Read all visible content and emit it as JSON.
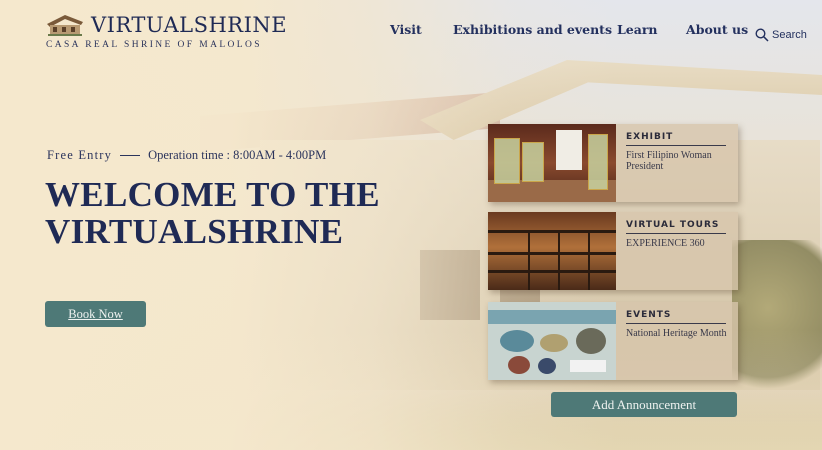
{
  "header": {
    "logo_title": "VIRTUALSHRINE",
    "logo_subtitle": "CASA REAL SHRINE OF MALOLOS",
    "nav": [
      "Visit",
      "Exhibitions and events",
      "Learn",
      "About us"
    ],
    "search_label": "Search"
  },
  "hero": {
    "free_entry": "Free Entry",
    "operation_time": "Operation time : 8:00AM - 4:00PM",
    "title": "WELCOME TO THE VIRTUALSHRINE",
    "book_button": "Book Now"
  },
  "cards": [
    {
      "label": "EXHIBIT",
      "description": "First Filipino Woman President"
    },
    {
      "label": "VIRTUAL TOURS",
      "description": "EXPERIENCE 360"
    },
    {
      "label": "EVENTS",
      "description": "National Heritage Month"
    }
  ],
  "add_button": "Add Announcement",
  "colors": {
    "navy": "#1f2a55",
    "teal_button": "#4e7977",
    "card_bg": "#d6c4aa"
  }
}
